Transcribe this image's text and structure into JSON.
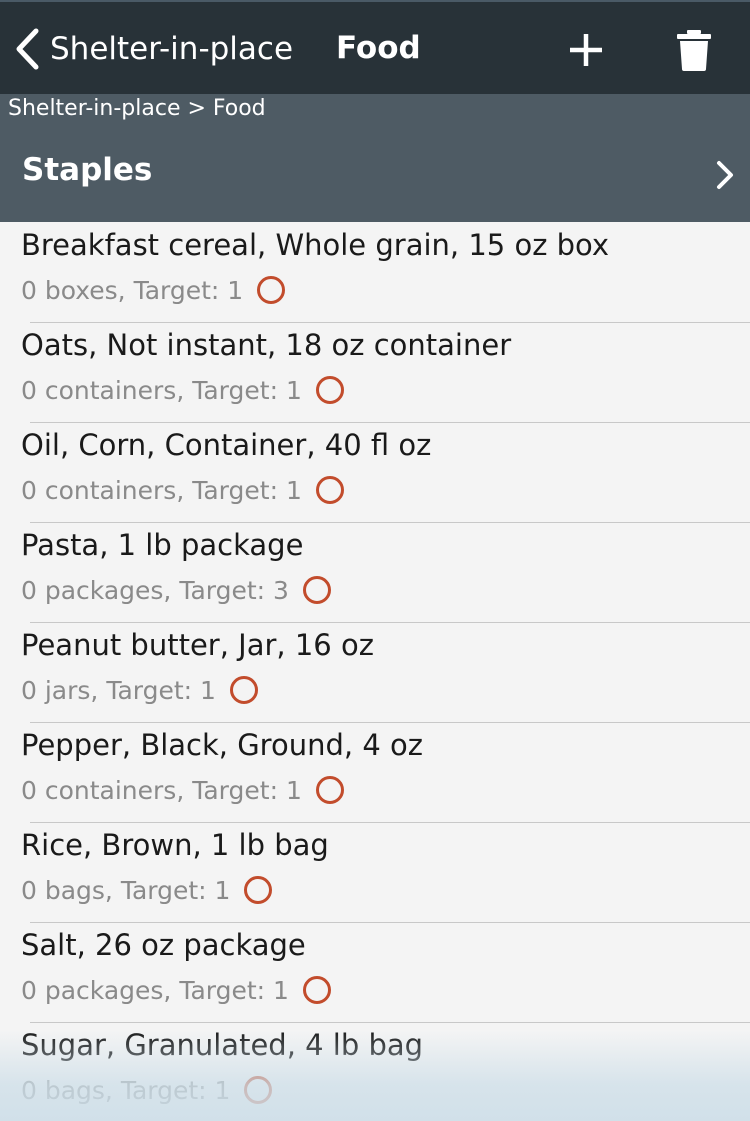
{
  "navbar": {
    "back_label": "Shelter-in-place",
    "title": "Food",
    "add_icon": "plus-icon",
    "delete_icon": "trash-icon"
  },
  "breadcrumb": "Shelter-in-place >  Food",
  "section": {
    "title": "Staples",
    "chevron_icon": "chevron-right-icon"
  },
  "items": [
    {
      "title": "Breakfast cereal, Whole grain, 15 oz box",
      "status": "0 boxes, Target: 1"
    },
    {
      "title": "Oats, Not instant, 18 oz container",
      "status": "0 containers, Target: 1"
    },
    {
      "title": "Oil, Corn, Container, 40 fl oz",
      "status": "0 containers, Target: 1"
    },
    {
      "title": "Pasta, 1 lb package",
      "status": "0 packages, Target: 3"
    },
    {
      "title": "Peanut butter, Jar, 16 oz",
      "status": "0 jars, Target: 1"
    },
    {
      "title": "Pepper, Black, Ground, 4 oz",
      "status": "0 containers, Target: 1"
    },
    {
      "title": "Rice, Brown, 1 lb bag",
      "status": "0 bags, Target: 1"
    },
    {
      "title": "Salt, 26 oz package",
      "status": "0 packages, Target: 1"
    },
    {
      "title": "Sugar, Granulated, 4 lb bag",
      "status": "0 bags, Target: 1"
    }
  ],
  "colors": {
    "navbar_bg": "#283238",
    "subheader_bg": "#4e5b64",
    "status_circle": "#c24c2c",
    "list_bg": "#f4f4f4"
  }
}
